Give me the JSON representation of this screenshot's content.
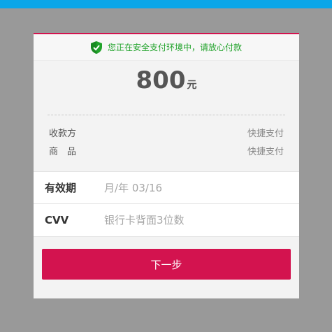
{
  "colors": {
    "top_bar": "#0aa6e8",
    "accent": "#d3134f",
    "secure_text": "#21a32b",
    "background": "#999999"
  },
  "secure_banner": {
    "icon": "shield-check-icon",
    "text": "您正在安全支付环境中，请放心付款"
  },
  "amount": {
    "value": "800",
    "unit": "元"
  },
  "info": [
    {
      "label": "收款方",
      "value": "快捷支付"
    },
    {
      "label": "商　品",
      "value": "快捷支付"
    }
  ],
  "fields": {
    "expiry": {
      "label": "有效期",
      "placeholder": "月/年 03/16"
    },
    "cvv": {
      "label": "CVV",
      "placeholder": "银行卡背面3位数"
    }
  },
  "next_button": {
    "label": "下一步"
  }
}
